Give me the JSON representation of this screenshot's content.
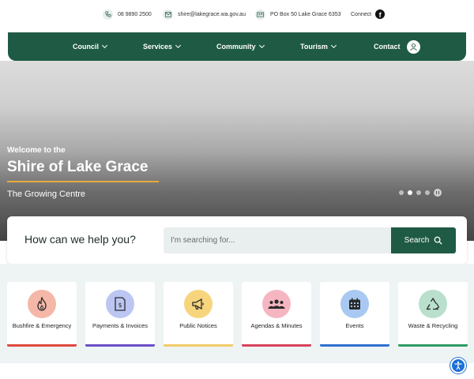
{
  "topbar": {
    "phone": "08 9890 2500",
    "email": "shire@lakegrace.wa.gov.au",
    "postal": "PO Box 50 Lake Grace 6353",
    "connect": "Connect"
  },
  "nav": {
    "items": [
      {
        "label": "Council"
      },
      {
        "label": "Services"
      },
      {
        "label": "Community"
      },
      {
        "label": "Tourism"
      }
    ],
    "contact": "Contact"
  },
  "hero": {
    "welcome": "Welcome to the",
    "title": "Shire of Lake Grace",
    "tagline": "The Growing Centre",
    "slides_total": 4,
    "slide_active": 2
  },
  "help": {
    "question": "How can we help you?",
    "placeholder": "I'm searching for...",
    "button": "Search"
  },
  "quick_links": [
    {
      "label": "Bushfire & Emergency",
      "icon": "fire-icon",
      "color": "#f4b7a8",
      "bar": "#e0483c"
    },
    {
      "label": "Payments & Invoices",
      "icon": "invoice-icon",
      "color": "#bcc6f3",
      "bar": "#6a4fc7"
    },
    {
      "label": "Public Notices",
      "icon": "megaphone-icon",
      "color": "#f6d57e",
      "bar": "#f0cc6a"
    },
    {
      "label": "Agendas & Minutes",
      "icon": "people-icon",
      "color": "#f5b6c2",
      "bar": "#d8435e"
    },
    {
      "label": "Events",
      "icon": "calendar-icon",
      "color": "#a9c9f2",
      "bar": "#2f6fd0"
    },
    {
      "label": "Waste & Recycling",
      "icon": "recycle-icon",
      "color": "#b9dfcd",
      "bar": "#2f9b62"
    }
  ],
  "colors": {
    "brand": "#1f5a45",
    "accent": "#e8a93a"
  }
}
